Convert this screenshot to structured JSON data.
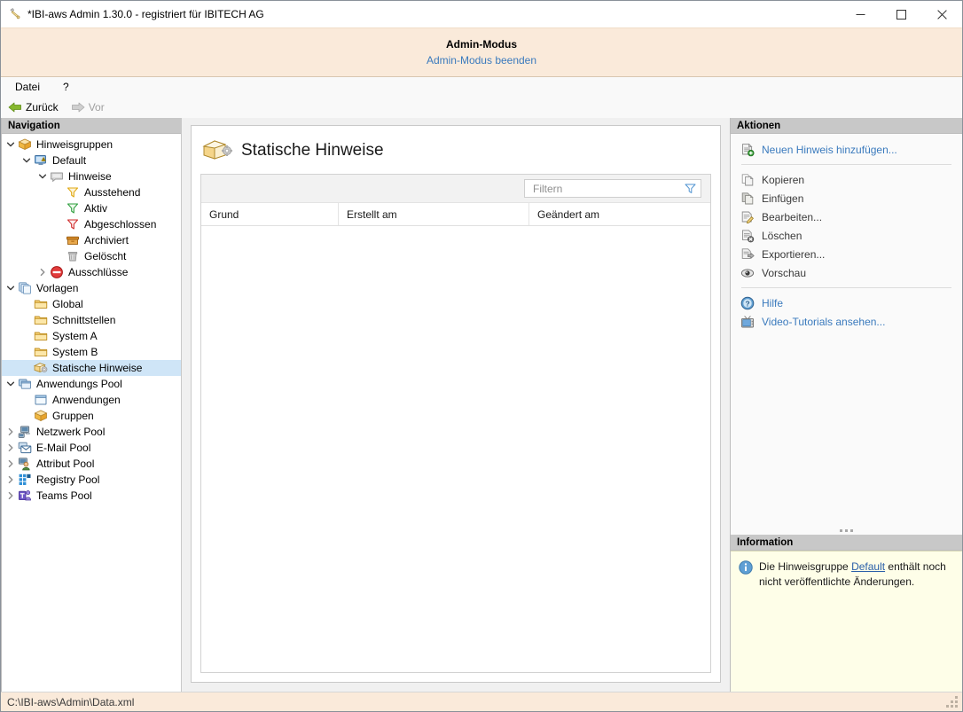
{
  "window": {
    "title": "*IBI-aws Admin 1.30.0 - registriert für IBITECH AG",
    "icon": "wrench-icon",
    "minimize": "—",
    "maximize": "☐",
    "close": "✕"
  },
  "admin_banner": {
    "title": "Admin-Modus",
    "exit_link": "Admin-Modus beenden"
  },
  "menubar": {
    "items": [
      {
        "label": "Datei",
        "name": "menu-datei"
      },
      {
        "label": "?",
        "name": "menu-help"
      }
    ]
  },
  "navbar": {
    "back": "Zurück",
    "forward": "Vor"
  },
  "navigation": {
    "header": "Navigation",
    "items": [
      {
        "label": "Hinweisgruppen",
        "indent": 0,
        "chevron": "down",
        "icon": "package-icon",
        "selected": false
      },
      {
        "label": "Default",
        "indent": 1,
        "chevron": "down",
        "icon": "monitor-warning-icon",
        "selected": false
      },
      {
        "label": "Hinweise",
        "indent": 2,
        "chevron": "down",
        "icon": "message-icon",
        "selected": false
      },
      {
        "label": "Ausstehend",
        "indent": 3,
        "chevron": "none",
        "icon": "funnel-yellow-icon",
        "selected": false
      },
      {
        "label": "Aktiv",
        "indent": 3,
        "chevron": "none",
        "icon": "funnel-green-icon",
        "selected": false
      },
      {
        "label": "Abgeschlossen",
        "indent": 3,
        "chevron": "none",
        "icon": "funnel-red-icon",
        "selected": false
      },
      {
        "label": "Archiviert",
        "indent": 3,
        "chevron": "none",
        "icon": "archive-box-icon",
        "selected": false
      },
      {
        "label": "Gelöscht",
        "indent": 3,
        "chevron": "none",
        "icon": "trash-icon",
        "selected": false
      },
      {
        "label": "Ausschlüsse",
        "indent": 2,
        "chevron": "right",
        "icon": "deny-icon",
        "selected": false
      },
      {
        "label": "Vorlagen",
        "indent": 0,
        "chevron": "down",
        "icon": "templates-icon",
        "selected": false
      },
      {
        "label": "Global",
        "indent": 1,
        "chevron": "none",
        "icon": "folder-icon",
        "selected": false
      },
      {
        "label": "Schnittstellen",
        "indent": 1,
        "chevron": "none",
        "icon": "folder-icon",
        "selected": false
      },
      {
        "label": "System A",
        "indent": 1,
        "chevron": "none",
        "icon": "folder-icon",
        "selected": false
      },
      {
        "label": "System B",
        "indent": 1,
        "chevron": "none",
        "icon": "folder-icon",
        "selected": false
      },
      {
        "label": "Statische Hinweise",
        "indent": 1,
        "chevron": "none",
        "icon": "static-notice-icon",
        "selected": true
      },
      {
        "label": "Anwendungs Pool",
        "indent": 0,
        "chevron": "down",
        "icon": "windows-stack-icon",
        "selected": false
      },
      {
        "label": "Anwendungen",
        "indent": 1,
        "chevron": "none",
        "icon": "window-icon",
        "selected": false
      },
      {
        "label": "Gruppen",
        "indent": 1,
        "chevron": "none",
        "icon": "package-icon",
        "selected": false
      },
      {
        "label": "Netzwerk Pool",
        "indent": 0,
        "chevron": "right",
        "icon": "network-icon",
        "selected": false
      },
      {
        "label": "E-Mail Pool",
        "indent": 0,
        "chevron": "right",
        "icon": "mail-icon",
        "selected": false
      },
      {
        "label": "Attribut Pool",
        "indent": 0,
        "chevron": "right",
        "icon": "user-attribute-icon",
        "selected": false
      },
      {
        "label": "Registry Pool",
        "indent": 0,
        "chevron": "right",
        "icon": "registry-icon",
        "selected": false
      },
      {
        "label": "Teams Pool",
        "indent": 0,
        "chevron": "right",
        "icon": "teams-icon",
        "selected": false
      }
    ]
  },
  "main": {
    "page_icon": "static-notice-icon",
    "page_title": "Statische Hinweise",
    "filter": {
      "placeholder": "Filtern",
      "value": "",
      "icon": "funnel-icon"
    },
    "grid": {
      "columns": [
        "Grund",
        "Erstellt am",
        "Geändert am"
      ],
      "rows": []
    }
  },
  "actions": {
    "header": "Aktionen",
    "groups": [
      {
        "items": [
          {
            "label": "Neuen Hinweis hinzufügen...",
            "icon": "document-add-icon",
            "style": "link"
          }
        ]
      },
      {
        "items": [
          {
            "label": "Kopieren",
            "icon": "copy-icon",
            "style": "normal"
          },
          {
            "label": "Einfügen",
            "icon": "paste-icon",
            "style": "normal"
          },
          {
            "label": "Bearbeiten...",
            "icon": "edit-icon",
            "style": "normal"
          },
          {
            "label": "Löschen",
            "icon": "delete-icon",
            "style": "normal"
          },
          {
            "label": "Exportieren...",
            "icon": "export-icon",
            "style": "normal"
          },
          {
            "label": "Vorschau",
            "icon": "eye-icon",
            "style": "normal"
          }
        ]
      },
      {
        "items": [
          {
            "label": "Hilfe",
            "icon": "help-icon",
            "style": "link"
          },
          {
            "label": "Video-Tutorials ansehen...",
            "icon": "tv-icon",
            "style": "link"
          }
        ]
      }
    ]
  },
  "information": {
    "header": "Information",
    "icon": "info-icon",
    "text_before": "Die Hinweisgruppe ",
    "link": "Default",
    "text_after": " enthält noch nicht veröffentlichte Änderungen."
  },
  "statusbar": {
    "path": "C:\\IBI-aws\\Admin\\Data.xml"
  },
  "colors": {
    "accent_link": "#3a7abd",
    "admin_banner_bg": "#faeada",
    "selection": "#cfe5f7",
    "info_bg": "#fefee8",
    "pane_header_bg": "#c8c8c8"
  }
}
